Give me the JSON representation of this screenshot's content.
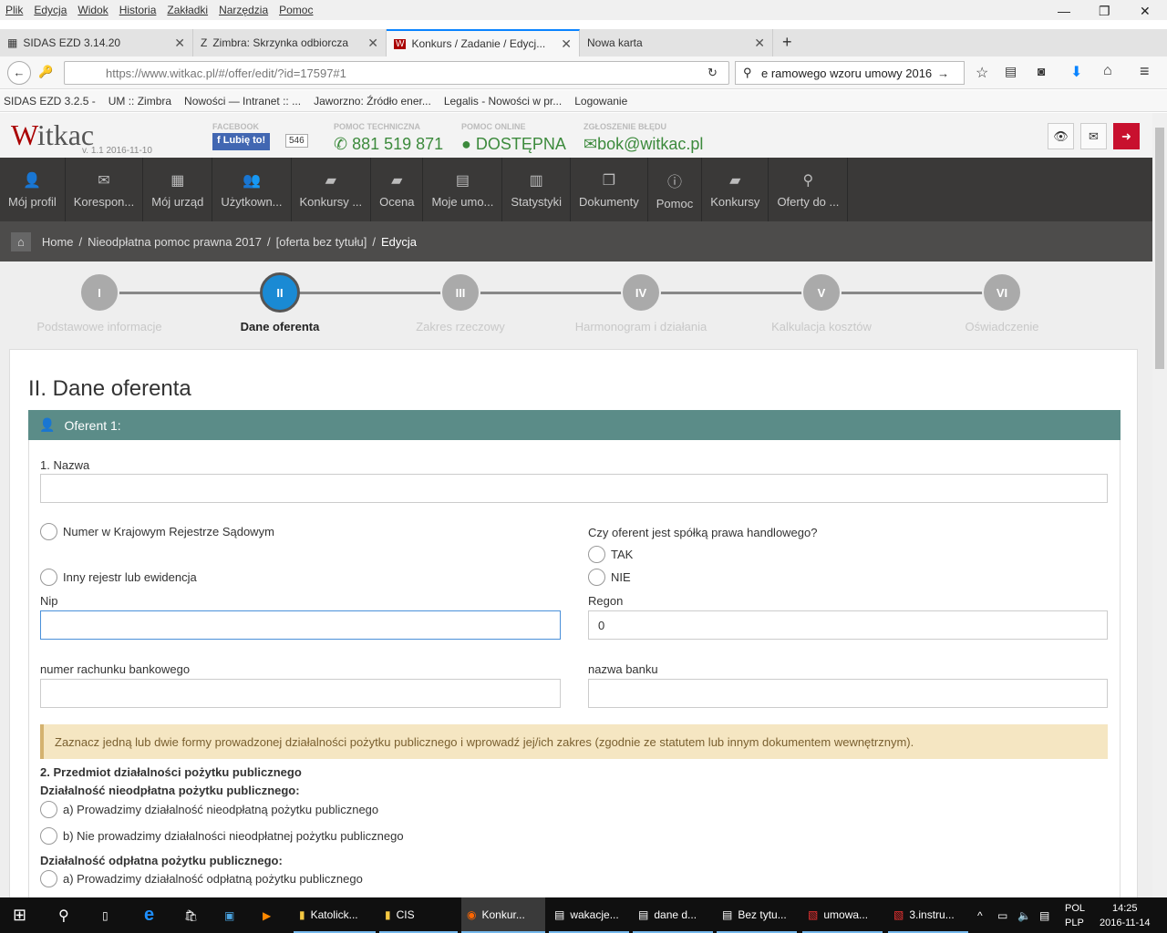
{
  "browser": {
    "menu": [
      "Plik",
      "Edycja",
      "Widok",
      "Historia",
      "Zakładki",
      "Narzędzia",
      "Pomoc"
    ],
    "tabs": [
      {
        "label": "SIDAS EZD 3.14.20"
      },
      {
        "label": "Zimbra: Skrzynka odbiorcza"
      },
      {
        "label": "Konkurs / Zadanie / Edycj..."
      },
      {
        "label": "Nowa karta"
      }
    ],
    "url": "https://www.witkac.pl/#/offer/edit/?id=17597#1",
    "search": "e ramowego wzoru umowy 2016",
    "bookmarks": [
      "SIDAS EZD 3.2.5 -",
      "UM :: Zimbra",
      "Nowości — Intranet :: ...",
      "Jaworzno: Źródło ener...",
      "Legalis - Nowości w pr...",
      "Logowanie"
    ]
  },
  "header": {
    "logo": "Witkac",
    "version": "v. 1.1 2016-11-10",
    "facebook_label": "FACEBOOK",
    "like": "Lubię to!",
    "like_count": "546",
    "tech_label": "POMOC TECHNICZNA",
    "phone": "881 519 871",
    "online_label": "POMOC ONLINE",
    "online": "DOSTĘPNA",
    "bug_label": "ZGŁOSZENIE BŁĘDU",
    "email": "bok@witkac.pl"
  },
  "nav": [
    {
      "label": "Mój profil",
      "icon": "user-icon"
    },
    {
      "label": "Korespon...",
      "icon": "envelope-icon"
    },
    {
      "label": "Mój urząd",
      "icon": "building-icon"
    },
    {
      "label": "Użytkown...",
      "icon": "users-icon"
    },
    {
      "label": "Konkursy ...",
      "icon": "book-icon"
    },
    {
      "label": "Ocena",
      "icon": "book-icon"
    },
    {
      "label": "Moje umo...",
      "icon": "document-icon"
    },
    {
      "label": "Statystyki",
      "icon": "chart-icon"
    },
    {
      "label": "Dokumenty",
      "icon": "copy-icon"
    },
    {
      "label": "Pomoc",
      "icon": "info-icon"
    },
    {
      "label": "Konkursy",
      "icon": "book-icon"
    },
    {
      "label": "Oferty do ...",
      "icon": "search-icon"
    }
  ],
  "breadcrumb": [
    "Home",
    "Nieodpłatna pomoc prawna 2017",
    "[oferta bez tytułu]",
    "Edycja"
  ],
  "steps": [
    {
      "num": "I",
      "label": "Podstawowe informacje"
    },
    {
      "num": "II",
      "label": "Dane oferenta",
      "active": true
    },
    {
      "num": "III",
      "label": "Zakres rzeczowy"
    },
    {
      "num": "IV",
      "label": "Harmonogram i działania"
    },
    {
      "num": "V",
      "label": "Kalkulacja kosztów"
    },
    {
      "num": "VI",
      "label": "Oświadczenie"
    }
  ],
  "form": {
    "title": "II. Dane oferenta",
    "panel": "Oferent 1:",
    "name_label": "1. Nazwa",
    "name_value": "",
    "krs": "Numer w Krajowym Rejestrze Sądowym",
    "other_reg": "Inny rejestr lub ewidencja",
    "spolka_q": "Czy oferent jest spółką prawa handlowego?",
    "tak": "TAK",
    "nie": "NIE",
    "nip_label": "Nip",
    "nip_value": "",
    "regon_label": "Regon",
    "regon_value": "0",
    "account_label": "numer rachunku bankowego",
    "account_value": "",
    "bank_label": "nazwa banku",
    "bank_value": "",
    "alert": "Zaznacz jedną lub dwie formy prowadzonej działalności pożytku publicznego i wprowadź jej/ich zakres (zgodnie ze statutem lub innym dokumentem wewnętrznym).",
    "section2": "2. Przedmiot działalności pożytku publicznego",
    "free_head": "Działalność nieodpłatna pożytku publicznego:",
    "free_a": "a) Prowadzimy działalność nieodpłatną pożytku publicznego",
    "free_b": "b) Nie prowadzimy działalności nieodpłatnej pożytku publicznego",
    "paid_head": "Działalność odpłatna pożytku publicznego:",
    "paid_a": "a) Prowadzimy działalność odpłatną pożytku publicznego"
  },
  "taskbar": {
    "items": [
      "Katolick...",
      "CIS",
      "Konkur...",
      "wakacje...",
      "dane d...",
      "Bez tytu...",
      "umowa...",
      "3.instru..."
    ],
    "lang1": "POL",
    "lang2": "PLP",
    "time": "14:25",
    "date": "2016-11-14"
  },
  "colors": {
    "panel": "#5b8c88",
    "active_step": "#1a8ad4",
    "nav": "#3a3938",
    "green": "#3c8a3c"
  }
}
